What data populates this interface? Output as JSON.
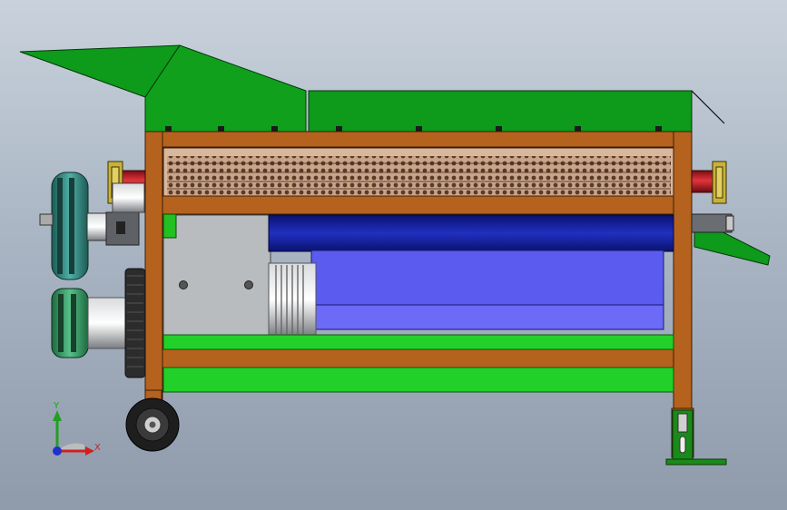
{
  "viewport": {
    "background_top": "#c9d2dc",
    "background_bottom": "#8f9bab"
  },
  "model": {
    "hopper_color": "#0e9a1a",
    "frame_color": "#b5621e",
    "shaft_red": "#c0202a",
    "flange_yellow": "#c9b23a",
    "drum_mesh_color": "#6b4a30",
    "motor_blue": "#5b5bf0",
    "motor_dark_blue": "#1520a8",
    "gearbox_gray": "#b8bcbf",
    "pulley_color": "#2a7a72",
    "base_green": "#22d02a",
    "wheel_color": "#222222"
  },
  "triad": {
    "x_label": "X",
    "y_label": "Y",
    "x_color": "#d22020",
    "y_color": "#20a020",
    "z_color": "#2030d0"
  }
}
